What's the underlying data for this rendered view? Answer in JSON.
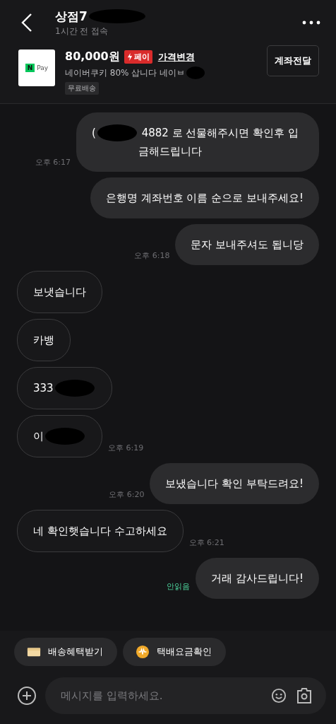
{
  "header": {
    "segments": [
      {
        "text": "상점7"
      },
      {
        "kind": "redaction"
      }
    ],
    "status": "1시간 전 접속"
  },
  "product": {
    "thumb_brand": "N",
    "thumb_label": "Pay",
    "price": "80,000원",
    "pay_badge": "페이",
    "price_change": "가격변경",
    "segments": [
      {
        "text": "네이버쿠키 80% 삽니다 네이ㅂ"
      },
      {
        "kind": "redaction"
      }
    ],
    "tag": "무료배송",
    "action": "계좌전달"
  },
  "messages": [
    {
      "kind": "sent",
      "segments": [
        {
          "text": "("
        },
        {
          "kind": "redaction"
        },
        {
          "text": " 4882 로 선물해주시면 확인후 입금해드립니다"
        }
      ],
      "time": "오후 6:17"
    },
    {
      "kind": "sent",
      "segments": [
        {
          "text": "은행명 계좌번호 이름 순으로 보내주세요!"
        }
      ]
    },
    {
      "kind": "sent",
      "segments": [
        {
          "text": "문자 보내주셔도 됩니당"
        }
      ],
      "time": "오후 6:18"
    },
    {
      "kind": "received",
      "segments": [
        {
          "text": "보냇습니다"
        }
      ]
    },
    {
      "kind": "received",
      "segments": [
        {
          "text": "카뱅"
        }
      ]
    },
    {
      "kind": "received",
      "segments": [
        {
          "text": "333"
        },
        {
          "kind": "redaction"
        }
      ]
    },
    {
      "kind": "received",
      "segments": [
        {
          "text": "이"
        },
        {
          "kind": "redaction"
        }
      ],
      "time": "오후 6:19"
    },
    {
      "kind": "sent",
      "segments": [
        {
          "text": "보냈습니다 확인 부탁드려요!"
        }
      ],
      "time": "오후 6:20"
    },
    {
      "kind": "received",
      "segments": [
        {
          "text": "네 확인햇습니다 수고하세요"
        }
      ],
      "time": "오후 6:21"
    },
    {
      "kind": "sent",
      "segments": [
        {
          "text": "거래 감사드립니다!"
        }
      ],
      "unread": "안읽음"
    }
  ],
  "quick_actions": [
    {
      "kind": "box",
      "label": "배송혜택받기"
    },
    {
      "kind": "coin",
      "label": "택배요금확인"
    }
  ],
  "composer": {
    "placeholder": "메시지를 입력하세요."
  }
}
